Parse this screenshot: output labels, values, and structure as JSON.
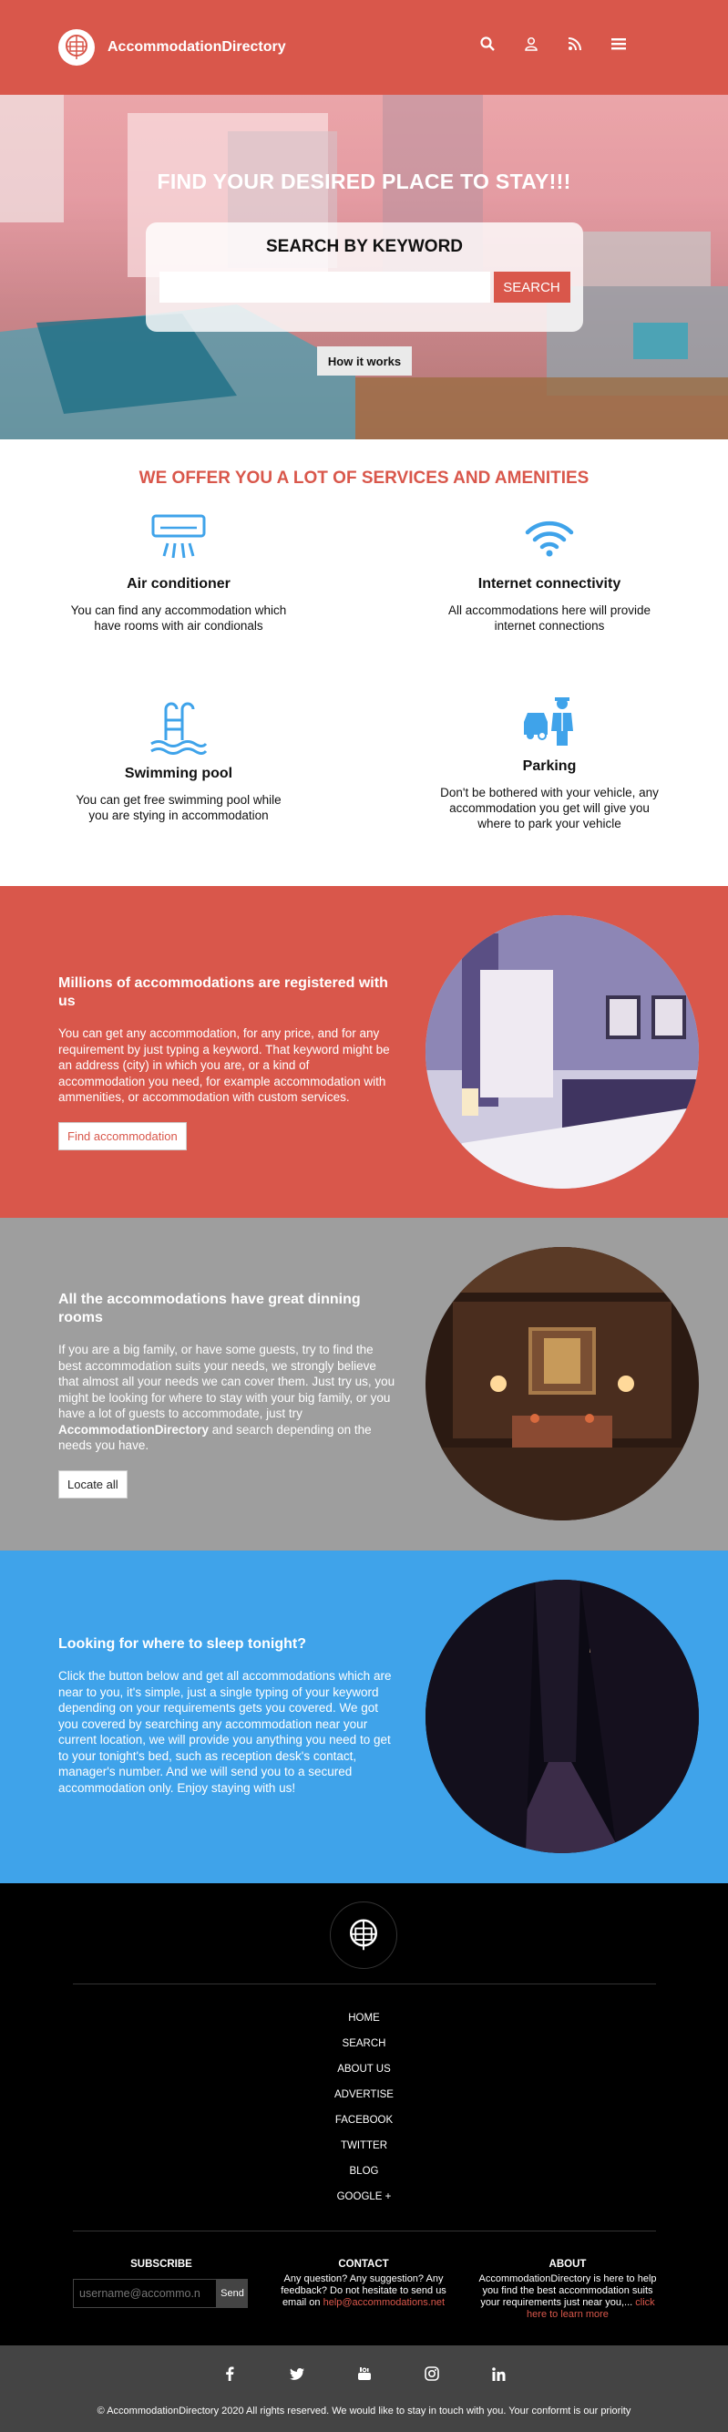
{
  "header": {
    "brand": "AccommodationDirectory",
    "icons": [
      "search-icon",
      "user-icon",
      "rss-icon",
      "menu-icon"
    ],
    "color": "#d9574b"
  },
  "hero": {
    "title": "FIND YOUR DESIRED PLACE TO STAY!!!",
    "search_title": "SEARCH BY KEYWORD",
    "search_value": "",
    "search_button": "SEARCH",
    "how_button": "How it works"
  },
  "services": {
    "title": "WE OFFER YOU A LOT OF SERVICES AND AMENITIES",
    "items": [
      {
        "name": "Air conditioner",
        "desc": "You can find any accommodation which have rooms with air condionals",
        "icon": "air-conditioner-icon"
      },
      {
        "name": "Internet connectivity",
        "desc": "All accommodations here will provide internet connections",
        "icon": "wifi-icon"
      },
      {
        "name": "Swimming pool",
        "desc": "You can get free swimming pool while you are stying in accommodation",
        "icon": "pool-icon"
      },
      {
        "name": "Parking",
        "desc": "Don't be bothered with your vehicle, any accommodation you get will give you where to park your vehicle",
        "icon": "parking-valet-icon"
      }
    ]
  },
  "bands": {
    "registered": {
      "title": "Millions of accommodations are registered with us",
      "body": "You can get any accommodation, for any price, and for any requirement by just typing a keyword. That keyword might be an address (city) in which you are, or a kind of accommodation you need, for example accommodation with ammenities, or accommodation with custom services.",
      "button": "Find accommodation"
    },
    "dining": {
      "title": "All the accommodations have great dinning rooms",
      "body_pre": "If you are a big family, or have some guests, try to find the best accommodation suits your needs, we strongly believe that almost all your needs we can cover them. Just try us, you might be looking for where to stay with your big family, or you have a lot of guests to accommodate, just try ",
      "body_brand": "AccommodationDirectory",
      "body_post": " and search depending on the needs you have.",
      "button": "Locate all"
    },
    "tonight": {
      "title": "Looking for where to sleep tonight?",
      "body": "Click the button below and get all accommodations which are near to you, it's simple, just a single typing of your keyword depending on your requirements gets you covered. We got you covered by searching any accommodation near your current location, we will provide you anything you need to get to your tonight's bed, such as reception desk's contact, manager's number. And we will send you to a secured accommodation only. Enjoy staying with us!"
    }
  },
  "footer": {
    "nav": [
      "HOME",
      "SEARCH",
      "ABOUT US",
      "ADVERTISE",
      "FACEBOOK",
      "TWITTER",
      "BLOG",
      "GOOGLE +"
    ],
    "subscribe": {
      "title": "SUBSCRIBE",
      "placeholder": "username@accommo.n",
      "button": "Send"
    },
    "contact": {
      "title": "CONTACT",
      "text": "Any question? Any suggestion? Any feedback? Do not hesitate to send us email on ",
      "email": "help@accommodations.net"
    },
    "about": {
      "title": "ABOUT",
      "text": "AccommodationDirectory is here to help you find the best accommodation suits your requirements just near you,... ",
      "link": "click here to learn more"
    },
    "socials": [
      "facebook-icon",
      "twitter-icon",
      "youtube-icon",
      "instagram-icon",
      "linkedin-icon"
    ],
    "copyright": "© AccommodationDirectory 2020 All rights reserved. We would like to stay in touch with you. Your conformt is our priority"
  }
}
